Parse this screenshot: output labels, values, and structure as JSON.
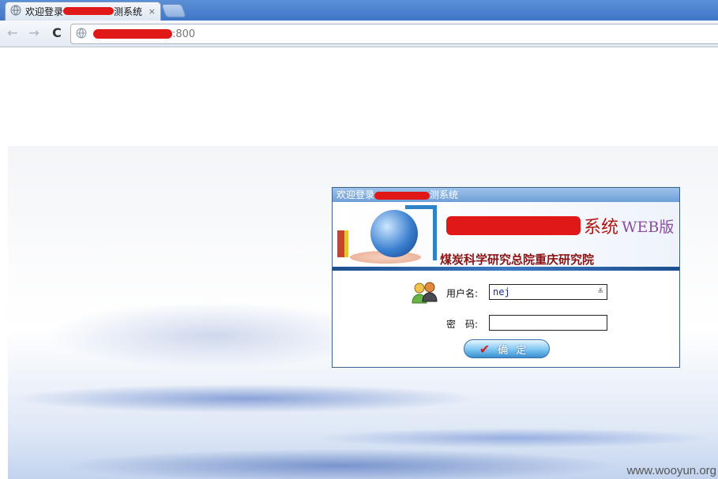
{
  "browser": {
    "tab_title": "欢迎登录",
    "tab_title_tail": "测系统",
    "tab_close": "×",
    "url_suffix": ":800",
    "back": "←",
    "forward": "→",
    "reload": "C"
  },
  "login": {
    "window_title": "欢迎登录",
    "window_title_tail": "测系统",
    "system_title_suffix": "系统",
    "system_title_web": "WEB版",
    "organization": "煤炭科学研究总院重庆研究院",
    "username_label": "用户名:",
    "username_value": "nej",
    "password_label": "密　码:",
    "submit_label": "确定",
    "combo_arrow": "≚"
  },
  "page": {
    "watermark": "www.wooyun.org"
  },
  "colors": {
    "redaction": "#e01818",
    "title_red": "#b0150f",
    "accent_blue": "#3f76c7"
  },
  "icons": [
    "globe-icon",
    "close-icon",
    "back-arrow-icon",
    "forward-arrow-icon",
    "reload-icon",
    "users-icon",
    "check-icon"
  ]
}
